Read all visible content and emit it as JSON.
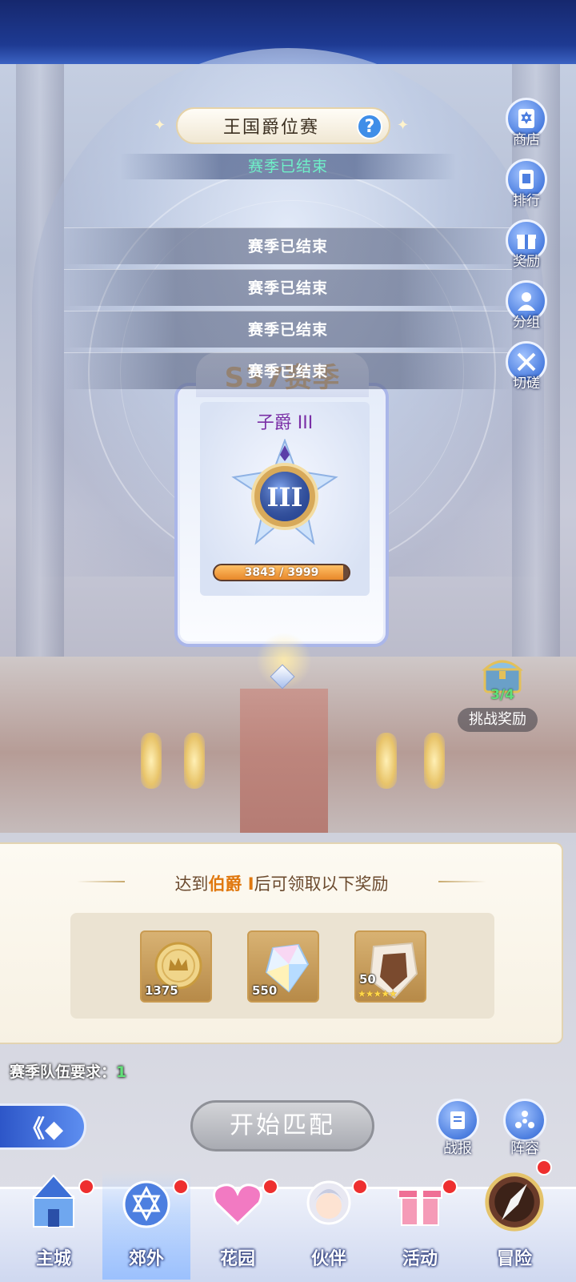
{
  "header": {
    "title": "王国爵位赛",
    "help_icon": "?",
    "status": "赛季已结束"
  },
  "notices": [
    "赛季已结束",
    "赛季已结束",
    "赛季已结束",
    "赛季已结束"
  ],
  "rank_card": {
    "season_label": "S37赛季",
    "rank_name": "子爵 III",
    "badge_numeral": "III",
    "progress_current": 3843,
    "progress_max": 3999,
    "progress_text": "3843 / 3999"
  },
  "sidebar": [
    {
      "label": "商店",
      "icon": "shop-icon"
    },
    {
      "label": "排行",
      "icon": "ranking-icon"
    },
    {
      "label": "奖励",
      "icon": "gift-icon"
    },
    {
      "label": "分组",
      "icon": "group-icon"
    },
    {
      "label": "切磋",
      "icon": "crossed-swords-icon"
    }
  ],
  "challenge": {
    "count": "3/4",
    "label": "挑战奖励"
  },
  "rewards": {
    "title_prefix": "达到",
    "title_rank": "伯爵 I",
    "title_suffix": "后可领取以下奖励",
    "items": [
      {
        "name": "crown-coin",
        "qty": "1375"
      },
      {
        "name": "crystal",
        "qty": "550"
      },
      {
        "name": "stone-shard",
        "qty": "50",
        "stars": "★★★★★"
      }
    ]
  },
  "team_requirement": {
    "label": "赛季队伍要求：",
    "value": "1"
  },
  "actions": {
    "back_icon": "《◆",
    "match_label": "开始匹配",
    "report_label": "战报",
    "lineup_label": "阵容"
  },
  "nav": [
    {
      "label": "主城",
      "badge": true
    },
    {
      "label": "郊外",
      "badge": true,
      "active": true
    },
    {
      "label": "花园",
      "badge": true
    },
    {
      "label": "伙伴",
      "badge": true
    },
    {
      "label": "活动",
      "badge": true
    },
    {
      "label": "冒险",
      "badge": true
    }
  ],
  "colors": {
    "accent_blue": "#4d7fe0",
    "status_green": "#6ff0c8",
    "rank_purple": "#7a2fa6",
    "highlight_orange": "#e0780f",
    "badge_red": "#ee2f2f"
  }
}
